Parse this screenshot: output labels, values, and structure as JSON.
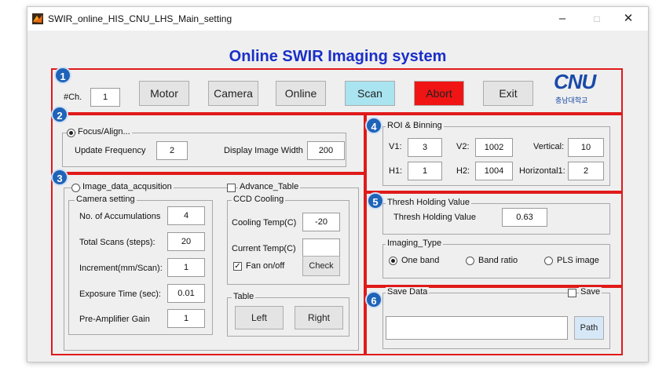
{
  "window": {
    "title": "SWIR_online_HIS_CNU_LHS_Main_setting",
    "min": "–",
    "max": "□",
    "close": "✕"
  },
  "heading": "Online SWIR Imaging system",
  "badges": [
    "1",
    "2",
    "3",
    "4",
    "5",
    "6"
  ],
  "top": {
    "ch_label": "#Ch.",
    "ch_value": "1",
    "motor": "Motor",
    "camera": "Camera",
    "online": "Online",
    "scan": "Scan",
    "abort": "Abort",
    "exit": "Exit",
    "logo_text": "CNU",
    "logo_sub": "충남대학교",
    "colors": {
      "scan_bg": "#a9e4f0",
      "abort_bg": "#f01414"
    }
  },
  "focus": {
    "radio_label": "Focus/Align...",
    "update_label": "Update Frequency",
    "update_value": "2",
    "display_label": "Display Image Width",
    "display_value": "200"
  },
  "acquisition": {
    "radio_label": "Image_data_acqusition",
    "advance_label": "Advance_Table",
    "camera_setting": "Camera setting",
    "rows": [
      {
        "label": "No. of Accumulations",
        "value": "4"
      },
      {
        "label": "Total Scans (steps):",
        "value": "20"
      },
      {
        "label": "Increment(mm/Scan):",
        "value": "1"
      },
      {
        "label": "Exposure Time (sec):",
        "value": "0.01"
      },
      {
        "label": "Pre-Amplifier Gain",
        "value": "1"
      }
    ],
    "ccd": {
      "title": "CCD Cooling",
      "cooling_label": "Cooling Temp(C)",
      "cooling_value": "-20",
      "current_label": "Current Temp(C)",
      "current_value": "",
      "fan_label": "Fan on/off",
      "fan_checked": true,
      "check_btn": "Check"
    },
    "table": {
      "title": "Table",
      "left": "Left",
      "right": "Right"
    }
  },
  "roi": {
    "title": "ROI & Binning",
    "v1_label": "V1:",
    "v1": "3",
    "v2_label": "V2:",
    "v2": "1002",
    "vertical_label": "Vertical:",
    "vertical": "10",
    "h1_label": "H1:",
    "h1": "1",
    "h2_label": "H2:",
    "h2": "1004",
    "horizontal_label": "Horizontal1:",
    "horizontal": "2"
  },
  "thresh": {
    "title": "Thresh Holding Value",
    "label": "Thresh Holding Value",
    "value": "0.63",
    "imaging_title": "Imaging_Type",
    "one_band": "One band",
    "band_ratio": "Band ratio",
    "pls": "PLS image",
    "selected": "One band"
  },
  "save": {
    "title": "Save Data",
    "save_label": "Save",
    "path_value": "",
    "path_btn": "Path"
  }
}
